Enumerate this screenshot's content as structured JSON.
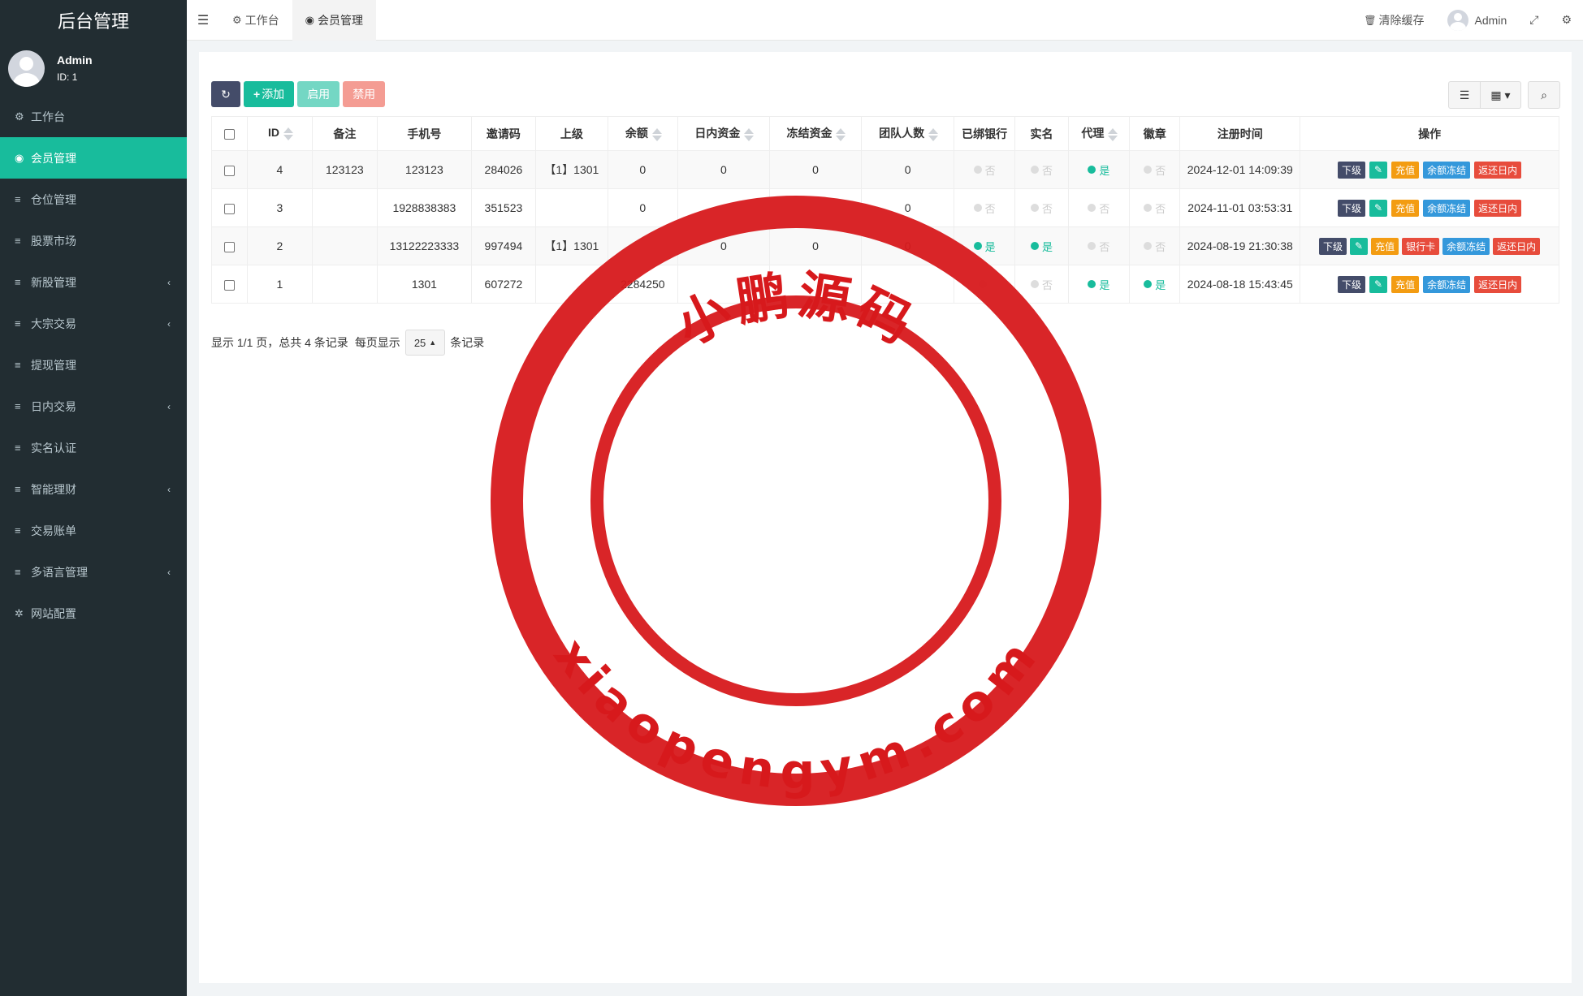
{
  "app": {
    "brand": "后台管理"
  },
  "user": {
    "name": "Admin",
    "id_label": "ID: 1"
  },
  "sidebar": {
    "items": [
      {
        "label": "工作台",
        "icon": "dashboard-icon"
      },
      {
        "label": "会员管理",
        "icon": "user-circle-icon",
        "active": true
      },
      {
        "label": "仓位管理",
        "icon": "list-icon"
      },
      {
        "label": "股票市场",
        "icon": "list-icon"
      },
      {
        "label": "新股管理",
        "icon": "list-icon",
        "expandable": true
      },
      {
        "label": "大宗交易",
        "icon": "list-icon",
        "expandable": true
      },
      {
        "label": "提现管理",
        "icon": "list-icon"
      },
      {
        "label": "日内交易",
        "icon": "list-icon",
        "expandable": true
      },
      {
        "label": "实名认证",
        "icon": "list-icon"
      },
      {
        "label": "智能理财",
        "icon": "list-icon",
        "expandable": true
      },
      {
        "label": "交易账单",
        "icon": "list-icon"
      },
      {
        "label": "多语言管理",
        "icon": "list-icon",
        "expandable": true
      },
      {
        "label": "网站配置",
        "icon": "gear-icon"
      }
    ]
  },
  "topbar": {
    "tabs": [
      {
        "label": "工作台"
      },
      {
        "label": "会员管理",
        "active": true
      }
    ],
    "clear_cache": "清除缓存",
    "admin": "Admin"
  },
  "toolbar": {
    "add": "添加",
    "enable": "启用",
    "disable": "禁用"
  },
  "table": {
    "headers": [
      "ID",
      "备注",
      "手机号",
      "邀请码",
      "上级",
      "余额",
      "日内资金",
      "冻结资金",
      "团队人数",
      "已绑银行",
      "实名",
      "代理",
      "徽章",
      "注册时间",
      "操作"
    ],
    "rows": [
      {
        "id": "4",
        "remark": "123123",
        "phone": "123123",
        "invite": "284026",
        "parent": "【1】1301",
        "balance": "0",
        "intraday": "0",
        "frozen": "0",
        "team": "0",
        "bank": "否",
        "realname": "否",
        "agent": "是",
        "badge": "否",
        "time": "2024-12-01 14:09:39"
      },
      {
        "id": "3",
        "remark": "",
        "phone": "1928838383",
        "invite": "351523",
        "parent": "",
        "balance": "0",
        "intraday": "",
        "frozen": "",
        "team": "0",
        "bank": "否",
        "realname": "否",
        "agent": "否",
        "badge": "否",
        "time": "2024-11-01 03:53:31"
      },
      {
        "id": "2",
        "remark": "",
        "phone": "13122223333",
        "invite": "997494",
        "parent": "【1】1301",
        "balance": "",
        "intraday": "0",
        "frozen": "0",
        "team": "0",
        "bank": "是",
        "realname": "是",
        "agent": "否",
        "badge": "否",
        "time": "2024-08-19 21:30:38"
      },
      {
        "id": "1",
        "remark": "",
        "phone": "1301",
        "invite": "607272",
        "parent": "",
        "balance": "2284250",
        "intraday": "",
        "frozen": "",
        "team": "",
        "bank": "",
        "realname": "否",
        "agent": "是",
        "badge": "是",
        "time": "2024-08-18 15:43:45"
      }
    ],
    "ops": {
      "xiaji": "下级",
      "chongzhi": "充值",
      "yinhangka": "银行卡",
      "dongjie": "余额冻结",
      "fanhuan": "返还日内"
    }
  },
  "pager": {
    "summary": "显示 1/1 页，总共 4 条记录",
    "per_page_label": "每页显示",
    "per_page": "25",
    "suffix": "条记录"
  },
  "watermark": {
    "title": "小鹏源码",
    "url": "xiaopengym.com",
    "color": "#d7191c"
  },
  "colors": {
    "sidebar_bg": "#222d32",
    "accent": "#18bc9c",
    "dark_btn": "#444c69",
    "warning": "#f39c12",
    "info": "#3498db",
    "danger": "#e74c3c"
  }
}
